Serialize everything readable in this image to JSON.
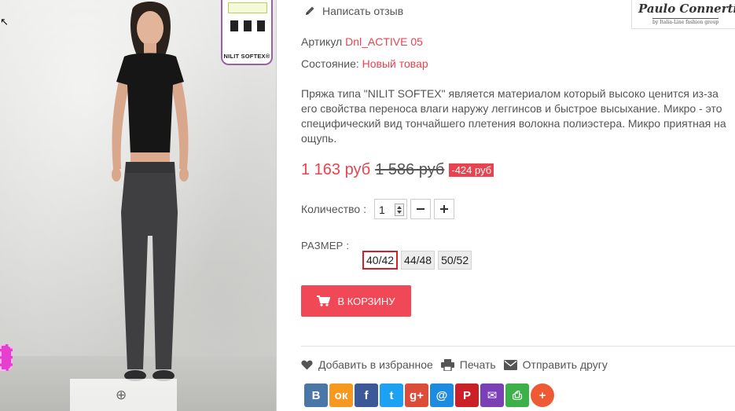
{
  "review_link": "Написать отзыв",
  "brand_logo": {
    "name": "Paulo Connerti",
    "tagline": "by Italia-Line fashion group"
  },
  "label_tag": {
    "brand": "NILIT SOFTEX®"
  },
  "article": {
    "label": "Артикул",
    "value": "Dnl_ACTIVE 05"
  },
  "condition": {
    "label": "Состояние:",
    "value": "Новый товар"
  },
  "description": "Пряжа типа \"NILIT SOFTEX\" является материалом который высоко ценится из-за его свойства переноса влаги наружу леггинсов и быстрое высыхание. Микро - это специфический вид тончайшего плетения волокна полиэстера. Микро приятная на ощупь.",
  "price": {
    "current": "1 163 руб",
    "old": "1 586 руб",
    "discount": "-424 руб"
  },
  "quantity": {
    "label": "Количество :",
    "value": "1"
  },
  "size": {
    "label": "РАЗМЕР :",
    "options": [
      "40/42",
      "44/48",
      "50/52"
    ],
    "selected": "40/42"
  },
  "cart_button": "В КОРЗИНУ",
  "actions": {
    "wishlist": "Добавить в избранное",
    "print": "Печать",
    "send": "Отправить другу"
  },
  "share": [
    {
      "icon": "vkontakte-icon",
      "glyph": "В",
      "color": "#4a76a8"
    },
    {
      "icon": "odnoklassniki-icon",
      "glyph": "ок",
      "color": "#f59a1f"
    },
    {
      "icon": "facebook-icon",
      "glyph": "f",
      "color": "#3b5998"
    },
    {
      "icon": "twitter-icon",
      "glyph": "t",
      "color": "#1da1f2"
    },
    {
      "icon": "google-plus-icon",
      "glyph": "g+",
      "color": "#dd4b39"
    },
    {
      "icon": "mail-ru-icon",
      "glyph": "@",
      "color": "#1d8be0"
    },
    {
      "icon": "pinterest-icon",
      "glyph": "P",
      "color": "#cb2027"
    },
    {
      "icon": "email-icon",
      "glyph": "✉",
      "color": "#7b40b5"
    },
    {
      "icon": "print-icon",
      "glyph": "⎙",
      "color": "#3cb14a"
    },
    {
      "icon": "more-icon",
      "glyph": "+",
      "color": "#ef5a35"
    }
  ]
}
